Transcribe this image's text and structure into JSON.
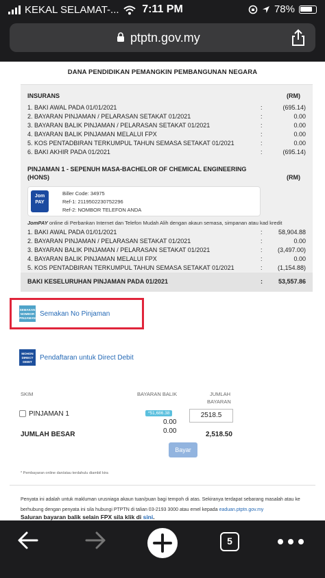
{
  "status_bar": {
    "carrier": "KEKAL SELAMAT-...",
    "time": "7:11 PM",
    "battery": "78%"
  },
  "browser": {
    "url": "ptptn.gov.my",
    "icons": [
      "lock-icon",
      "share-icon",
      "back-icon",
      "forward-icon",
      "new-tab-icon",
      "more-icon"
    ],
    "tab_count": "5"
  },
  "page": {
    "heading": "DANA PENDIDIKAN PEMANGKIN PEMBANGUNAN NEGARA",
    "insurans": {
      "title": "INSURANS",
      "unit": "(RM)",
      "rows": [
        {
          "label": "1.  BAKI AWAL PADA 01/01/2021",
          "colon": ":",
          "amount": "(695.14)"
        },
        {
          "label": "2.  BAYARAN PINJAMAN / PELARASAN SETAKAT 01/2021",
          "colon": ":",
          "amount": "0.00"
        },
        {
          "label": "3.  BAYARAN BALIK PINJAMAN / PELARASAN SETAKAT 01/2021",
          "colon": ":",
          "amount": "0.00"
        },
        {
          "label": "4.  BAYARAN BALIK PINJAMAN MELALUI FPX",
          "colon": ":",
          "amount": "0.00"
        },
        {
          "label": "5.  KOS PENTADBIRAN TERKUMPUL TAHUN SEMASA SETAKAT 01/2021",
          "colon": ":",
          "amount": "0.00"
        },
        {
          "label": "6.  BAKI AKHIR PADA 01/2021",
          "colon": ":",
          "amount": "(695.14)"
        }
      ]
    },
    "pinjaman": {
      "title_line1": "PINJAMAN 1 - SEPENUH MASA-BACHELOR OF CHEMICAL ENGINEERING",
      "title_line2": "(HONS)",
      "unit": "(RM)",
      "jompay": {
        "logo_line1": "Jom",
        "logo_line2": "PAY",
        "biller": "Biller Code: 34975",
        "ref1": "Ref-1: 2119502230752296",
        "ref2": "Ref-2: NOMBOR TELEFON ANDA",
        "note_bold": "JomPAY",
        "note": " online di Perbankan Internet dan Telefon Mudah Alih dengan akaun semasa, simpanan atau kad kredit"
      },
      "rows": [
        {
          "label": "1.  BAKI AWAL PADA 01/01/2021",
          "colon": ":",
          "amount": "58,904.88"
        },
        {
          "label": "2.  BAYARAN PINJAMAN / PELARASAN SETAKAT 01/2021",
          "colon": ":",
          "amount": "0.00"
        },
        {
          "label": "3.  BAYARAN BALIK PINJAMAN / PELARASAN SETAKAT 01/2021",
          "colon": ":",
          "amount": "(3,497.00)"
        },
        {
          "label": "4.  BAYARAN BALIK PINJAMAN MELALUI FPX",
          "colon": ":",
          "amount": "0.00"
        },
        {
          "label": "5.  KOS PENTADBIRAN TERKUMPUL TAHUN SEMASA SETAKAT 01/2021",
          "colon": ":",
          "amount": "(1,154.88)"
        },
        {
          "label": "6.  BAKI AKHIR PADA 01/2021",
          "colon": ":",
          "amount": "54,253.00"
        }
      ]
    },
    "total": {
      "label": "BAKI KESELURUHAN PINJAMAN PADA 01/2021",
      "colon": ":",
      "amount": "53,557.86"
    },
    "links": {
      "semakan_icon_text": "SEMAKAN NOMBOR PINJAMAN",
      "semakan": "Semakan No Pinjaman",
      "debit_icon_text": "MOHON DIRECT DEBIT",
      "debit": "Pendaftaran untuk Direct Debit"
    },
    "payment": {
      "col_skim": "SKIM",
      "col_bayaran": "BAYARAN BALIK",
      "col_jumlah_1": "JUMLAH",
      "col_jumlah_2": "BAYARAN",
      "item_label": "PINJAMAN 1",
      "badge": "*51,686.38",
      "item_amount": "0.00",
      "input_value": "2518.5",
      "total_label": "JUMLAH BESAR",
      "total_bayaran": "0.00",
      "total_jumlah": "2,518.50",
      "button": "Bayar"
    },
    "footnote": "* Pembayaran online dan/atau terdahulu diambil kira",
    "info_line1": "Penyata ini adalah untuk makluman urusniaga akaun tuan/puan bagi tempoh di atas. Sekiranya terdapat sebarang masalah atau ke",
    "info_line2": "berhubung dengan penyata ini sila hubungi PTPTN di talian 03-2193 3000 atau emel kepada",
    "info_email": "eaduan.ptptn.gov.my",
    "info_fpx": "Saluran bayaran balik selain FPX sila klik di",
    "info_fpx_link": "sini",
    "info_fpx_end": "."
  }
}
